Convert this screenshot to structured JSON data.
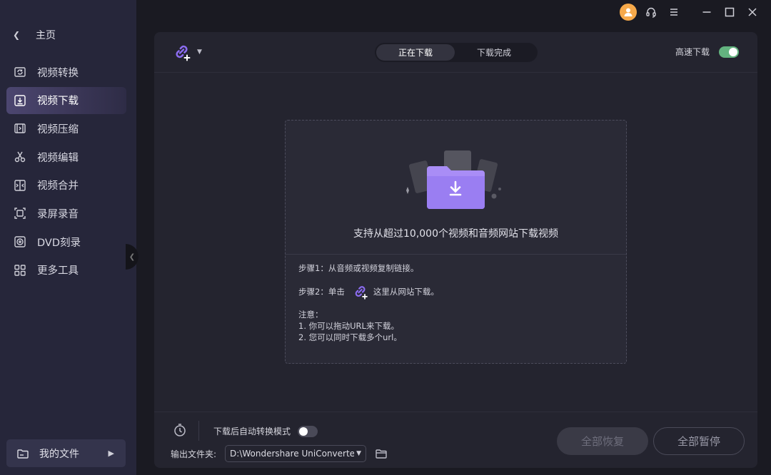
{
  "sidebar": {
    "home_label": "主页",
    "items": [
      {
        "label": "视频转换",
        "icon": "video-convert-icon"
      },
      {
        "label": "视频下载",
        "icon": "video-download-icon",
        "active": true
      },
      {
        "label": "视频压缩",
        "icon": "video-compress-icon"
      },
      {
        "label": "视频编辑",
        "icon": "scissors-icon"
      },
      {
        "label": "视频合并",
        "icon": "video-merge-icon"
      },
      {
        "label": "录屏录音",
        "icon": "screen-record-icon"
      },
      {
        "label": "DVD刻录",
        "icon": "dvd-icon"
      },
      {
        "label": "更多工具",
        "icon": "grid-tools-icon"
      }
    ],
    "my_files_label": "我的文件"
  },
  "colors": {
    "accent": "#8b6cf0",
    "toggle_on": "#63b37f",
    "avatar": "#f6a94a"
  },
  "header": {
    "tabs": [
      {
        "label": "正在下载",
        "active": true
      },
      {
        "label": "下载完成",
        "active": false
      }
    ],
    "speed_label": "高速下载",
    "speed_enabled": true
  },
  "drop_area": {
    "title": "支持从超过10,000个视频和音频网站下载视频",
    "step1": "步骤1：从音频或视频复制链接。",
    "step2_prefix": "步骤2：单击",
    "step2_suffix": "这里从网站下载。",
    "notes_title": "注意：",
    "note1": "1. 你可以拖动URL来下载。",
    "note2": "2. 您可以同时下载多个url。"
  },
  "footer": {
    "auto_convert_label": "下载后自动转换模式",
    "auto_convert_enabled": false,
    "output_label": "输出文件夹:",
    "output_path": "D:\\Wondershare UniConverter",
    "resume_all": "全部恢复",
    "pause_all": "全部暂停"
  }
}
